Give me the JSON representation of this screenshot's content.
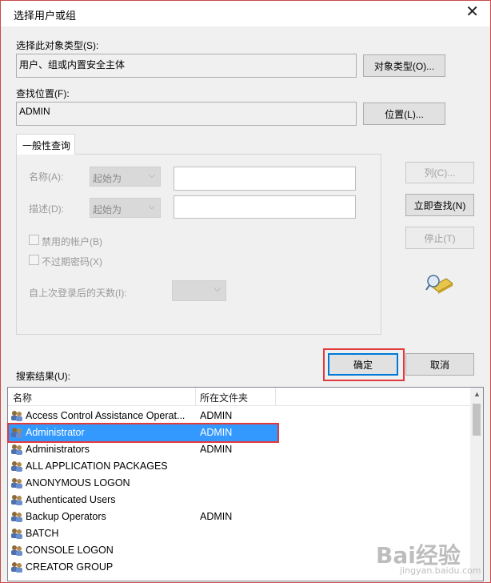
{
  "dialog": {
    "title": "选择用户或组",
    "close_glyph": "✕"
  },
  "object_type": {
    "label": "选择此对象类型(S):",
    "value": "用户、组或内置安全主体",
    "button": "对象类型(O)..."
  },
  "location": {
    "label": "查找位置(F):",
    "value": "ADMIN",
    "button": "位置(L)..."
  },
  "query": {
    "tab": "一般性查询",
    "name_label": "名称(A):",
    "name_mode": "起始为",
    "desc_label": "描述(D):",
    "desc_mode": "起始为",
    "disabled_accounts": "禁用的帐户(B)",
    "no_expire": "不过期密码(X)",
    "days_label": "自上次登录后的天数(I):"
  },
  "side_buttons": {
    "columns": "列(C)...",
    "find_now": "立即查找(N)",
    "stop": "停止(T)"
  },
  "actions": {
    "ok": "确定",
    "cancel": "取消"
  },
  "results": {
    "label": "搜索结果(U):",
    "columns": [
      "名称",
      "所在文件夹"
    ],
    "rows": [
      {
        "name": "Access Control Assistance Operat...",
        "folder": "ADMIN"
      },
      {
        "name": "Administrator",
        "folder": "ADMIN",
        "selected": true
      },
      {
        "name": "Administrators",
        "folder": "ADMIN"
      },
      {
        "name": "ALL APPLICATION PACKAGES",
        "folder": ""
      },
      {
        "name": "ANONYMOUS LOGON",
        "folder": ""
      },
      {
        "name": "Authenticated Users",
        "folder": ""
      },
      {
        "name": "Backup Operators",
        "folder": "ADMIN"
      },
      {
        "name": "BATCH",
        "folder": ""
      },
      {
        "name": "CONSOLE LOGON",
        "folder": ""
      },
      {
        "name": "CREATOR GROUP",
        "folder": ""
      }
    ]
  },
  "watermark": {
    "brand": "Bai经验",
    "url": "jingyan.baidu.com"
  },
  "colors": {
    "selection": "#3399ff",
    "highlight_box": "#e2393c",
    "ok_border": "#0078d7"
  }
}
